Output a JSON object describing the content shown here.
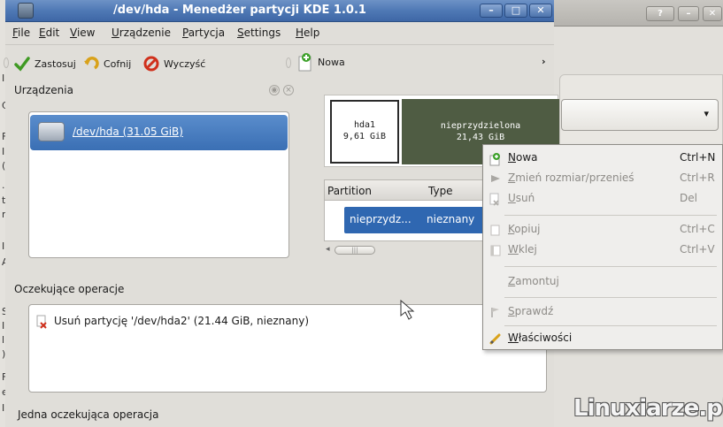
{
  "main_window": {
    "title": "/dev/hda - Menedżer partycji KDE 1.0.1",
    "controls": {
      "minimize": "–",
      "maximize": "□",
      "close": "✕"
    }
  },
  "menu": [
    "File",
    "Edit",
    "View",
    "Urządzenie",
    "Partycja",
    "Settings",
    "Help"
  ],
  "toolbar": {
    "apply": "Zastosuj",
    "undo": "Cofnij",
    "clear": "Wyczyść",
    "new": "Nowa",
    "overflow": "›"
  },
  "devices_panel": {
    "title": "Urządzenia",
    "items": [
      {
        "label": "/dev/hda (31.05 GiB)",
        "icon": "hard-disk-icon"
      }
    ]
  },
  "partition_graph": {
    "partitions": [
      {
        "name": "hda1",
        "size": "9,61 GiB",
        "color": "#ffffff"
      },
      {
        "name": "nieprzydzielona",
        "size": "21,43 GiB",
        "color": "#4f5c43"
      }
    ]
  },
  "partition_table": {
    "columns": [
      "Partition",
      "Type"
    ],
    "rows": [
      {
        "partition": "nieprzydz...",
        "type": "nieznany"
      }
    ]
  },
  "pending_panel": {
    "title": "Oczekujące operacje",
    "items": [
      "Usuń partycję '/dev/hda2' (21.44 GiB, nieznany)"
    ]
  },
  "statusbar": "Jedna oczekująca operacja",
  "context_menu": {
    "items": [
      {
        "label": "Nowa",
        "shortcut": "Ctrl+N",
        "enabled": true,
        "icon": "new-icon"
      },
      {
        "label": "Zmień rozmiar/przenieś",
        "shortcut": "Ctrl+R",
        "enabled": false,
        "icon": "resize-icon"
      },
      {
        "label": "Usuń",
        "shortcut": "Del",
        "enabled": false,
        "icon": "delete-icon"
      },
      {
        "label": "Kopiuj",
        "shortcut": "Ctrl+C",
        "enabled": false,
        "icon": "copy-icon"
      },
      {
        "label": "Wklej",
        "shortcut": "Ctrl+V",
        "enabled": false,
        "icon": "paste-icon"
      },
      {
        "label": "Zamontuj",
        "shortcut": "",
        "enabled": false,
        "icon": ""
      },
      {
        "label": "Sprawdź",
        "shortcut": "",
        "enabled": false,
        "icon": "check-icon"
      },
      {
        "label": "Właściwości",
        "shortcut": "",
        "enabled": true,
        "icon": "properties-icon"
      }
    ]
  },
  "background_window": {
    "controls": {
      "help": "?",
      "minimize": "–",
      "close": "✕"
    },
    "combo_arrow": "▾"
  },
  "left_strip": [
    "I",
    "C",
    "F",
    "I",
    "(",
    ".",
    "t",
    "r",
    "I",
    "A",
    "S",
    "I",
    "l",
    ")",
    "F",
    "e",
    "I"
  ],
  "watermark": "Linuxiarze.pl",
  "colors": {
    "titlebar": "#4f79b5",
    "selection": "#3a6fb4",
    "unallocated": "#4f5c43"
  }
}
